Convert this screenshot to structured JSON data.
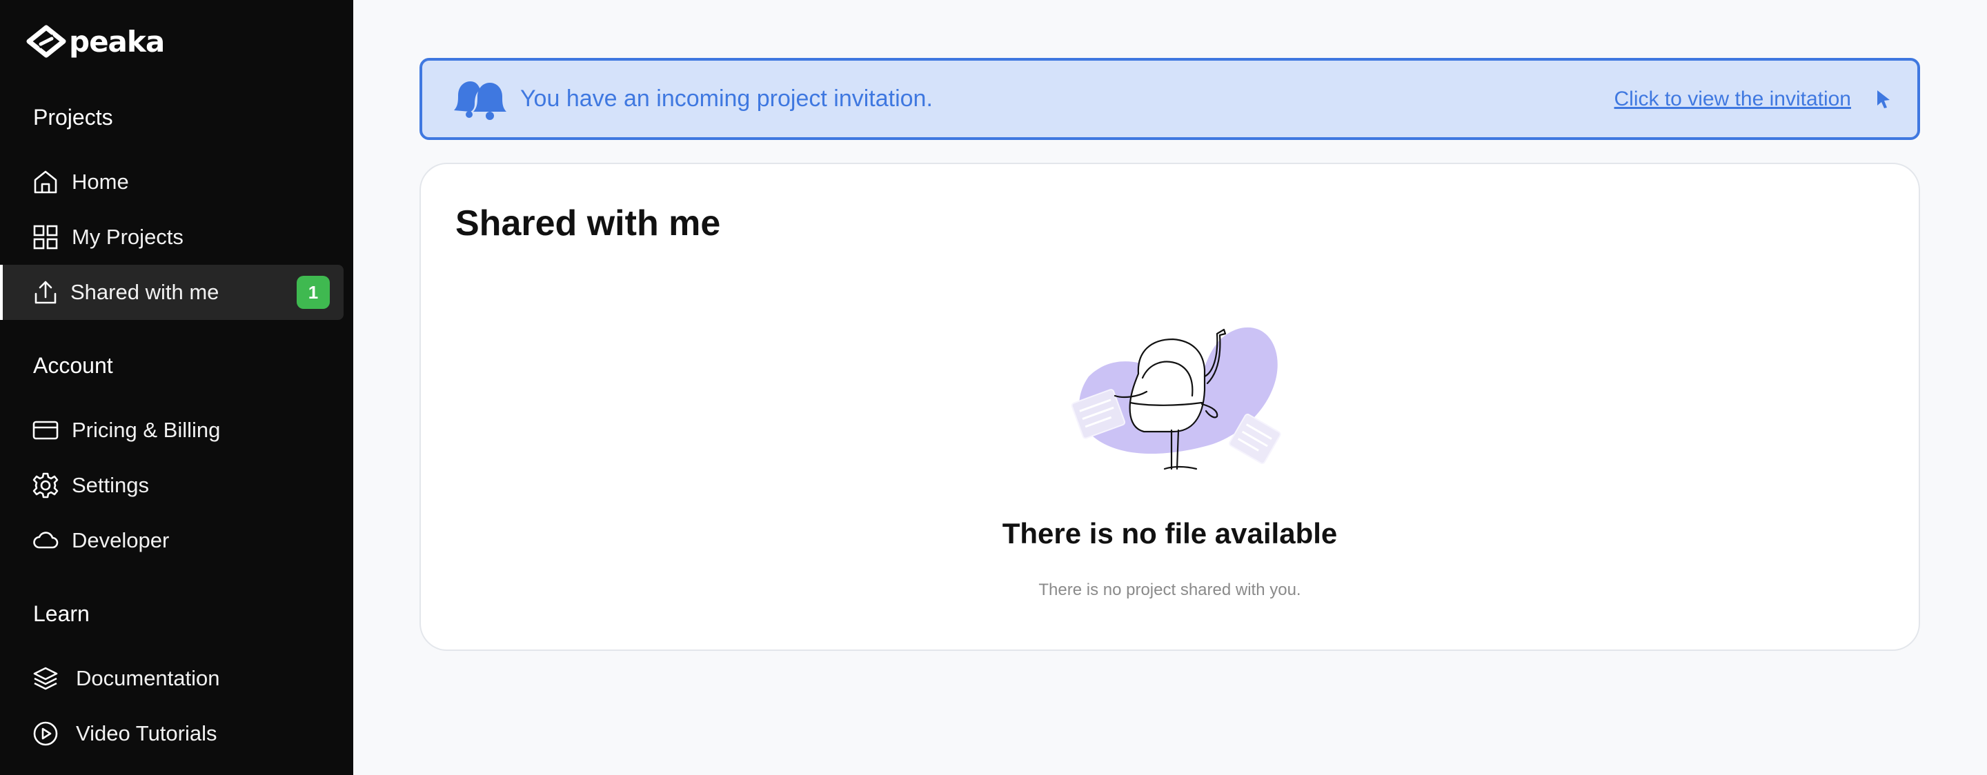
{
  "brand": {
    "name": "peaka"
  },
  "sidebar": {
    "sections": [
      {
        "title": "Projects",
        "items": [
          {
            "label": "Home",
            "icon": "home-icon"
          },
          {
            "label": "My Projects",
            "icon": "grid-icon"
          },
          {
            "label": "Shared with me",
            "icon": "share-icon",
            "active": true,
            "badge": "1"
          }
        ]
      },
      {
        "title": "Account",
        "items": [
          {
            "label": "Pricing & Billing",
            "icon": "credit-card-icon"
          },
          {
            "label": "Settings",
            "icon": "gear-icon"
          },
          {
            "label": "Developer",
            "icon": "cloud-icon"
          }
        ]
      },
      {
        "title": "Learn",
        "items": [
          {
            "label": "Documentation",
            "icon": "layers-icon"
          },
          {
            "label": "Video Tutorials",
            "icon": "play-circle-icon"
          }
        ]
      }
    ]
  },
  "banner": {
    "message": "You have an incoming project invitation.",
    "link_label": "Click to view the invitation",
    "icon": "bell-icon",
    "accent": "#3f78e0",
    "background": "#d5e2fa"
  },
  "main": {
    "title": "Shared with me",
    "empty_state": {
      "title": "There is no file available",
      "subtitle": "There is no project shared with you.",
      "illustration": "mailbox-illustration"
    }
  },
  "colors": {
    "sidebar_bg": "#0c0c0c",
    "badge": "#3fb950",
    "illustration_blob": "#cbc2f5"
  }
}
